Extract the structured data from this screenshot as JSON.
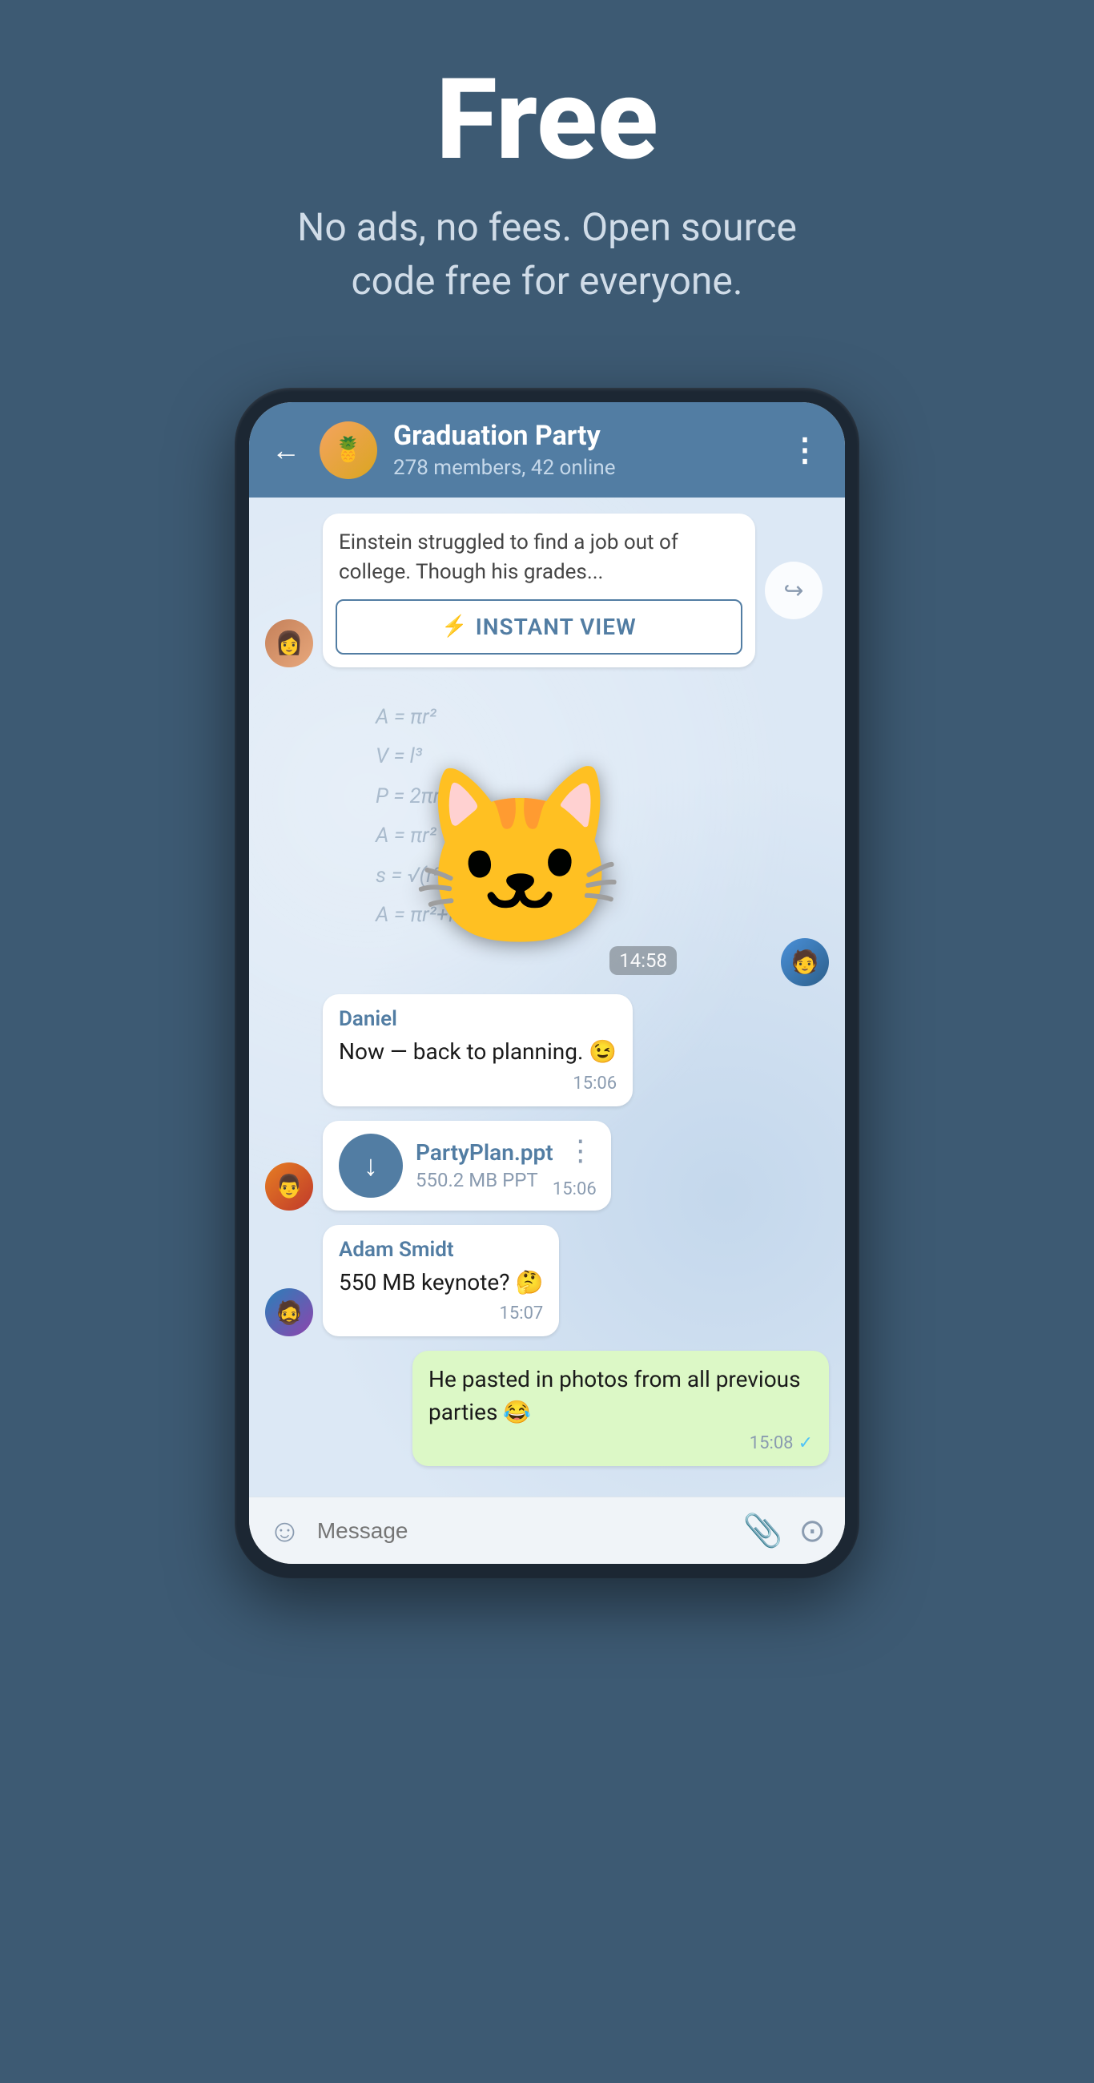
{
  "hero": {
    "title": "Free",
    "subtitle": "No ads, no fees. Open source code free for everyone."
  },
  "chat": {
    "back_label": "←",
    "group_name": "Graduation Party",
    "group_status": "278 members, 42 online",
    "menu_icon": "⋮",
    "link_preview_text": "Einstein struggled to find a job out of college. Though his grades...",
    "instant_view_label": "INSTANT VIEW",
    "instant_view_icon": "⚡",
    "sticker_time": "14:58",
    "share_icon": "↪",
    "messages": [
      {
        "id": "daniel-msg",
        "sender": "Daniel",
        "text": "Now — back to planning. 😉",
        "time": "15:06",
        "type": "text",
        "side": "left"
      },
      {
        "id": "file-msg",
        "file_name": "PartyPlan.ppt",
        "file_size": "550.2 MB PPT",
        "time": "15:06",
        "type": "file",
        "side": "left"
      },
      {
        "id": "adam-msg",
        "sender": "Adam Smidt",
        "text": "550 MB keynote? 🤔",
        "time": "15:07",
        "type": "text",
        "side": "left"
      },
      {
        "id": "self-msg",
        "text": "He pasted in photos from all previous parties 😂",
        "time": "15:08",
        "type": "text",
        "side": "right",
        "is_own": true
      }
    ],
    "input_placeholder": "Message",
    "emoji_icon": "☺",
    "attach_icon": "📎",
    "camera_icon": "⊙"
  }
}
